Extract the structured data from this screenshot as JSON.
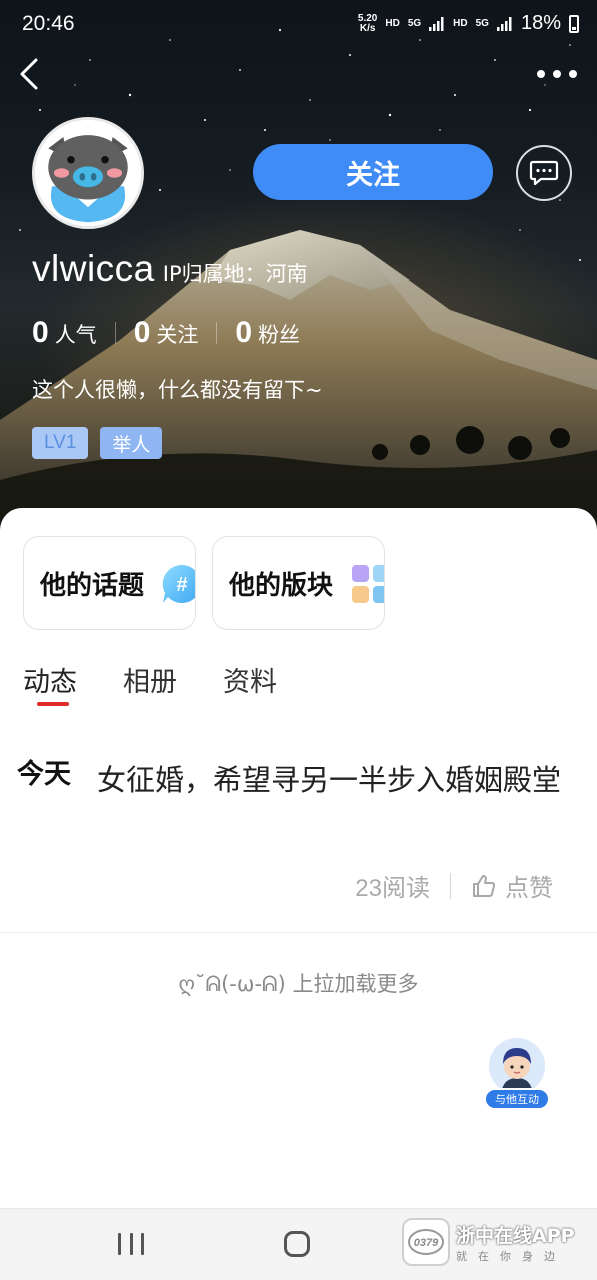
{
  "status_bar": {
    "time": "20:46",
    "net_speed_value": "5.20",
    "net_speed_unit": "K/s",
    "hd1": "HD",
    "net1": "5G",
    "hd2": "HD",
    "net2": "5G",
    "battery": "18%"
  },
  "profile": {
    "username": "vlwicca",
    "ip_location": "IP归属地：河南",
    "follow_label": "关注",
    "stats": [
      {
        "value": "0",
        "label": "人气"
      },
      {
        "value": "0",
        "label": "关注"
      },
      {
        "value": "0",
        "label": "粉丝"
      }
    ],
    "bio": "这个人很懒，什么都没有留下~",
    "level_badge": "LV1",
    "report_badge": "举人"
  },
  "shortcuts": {
    "topics_label": "他的话题",
    "boards_label": "他的版块"
  },
  "tabs": [
    {
      "label": "动态",
      "active": true
    },
    {
      "label": "相册",
      "active": false
    },
    {
      "label": "资料",
      "active": false
    }
  ],
  "post": {
    "date": "今天",
    "text": "女征婚，希望寻另一半步入婚姻殿堂",
    "read_count": "23阅读",
    "like_label": "点赞"
  },
  "load_more": "ღ˘ᕱ(-ω-ᕱ) 上拉加载更多",
  "chat_bot": {
    "label": "与他互动"
  },
  "watermark": {
    "logo_text": "0379",
    "title": "浙中在线APP",
    "subtitle": "就在你身边"
  },
  "colors": {
    "accent_blue": "#3f8cf7",
    "tab_indicator": "#e02a2a",
    "badge_blue": "#9ec1f4"
  }
}
